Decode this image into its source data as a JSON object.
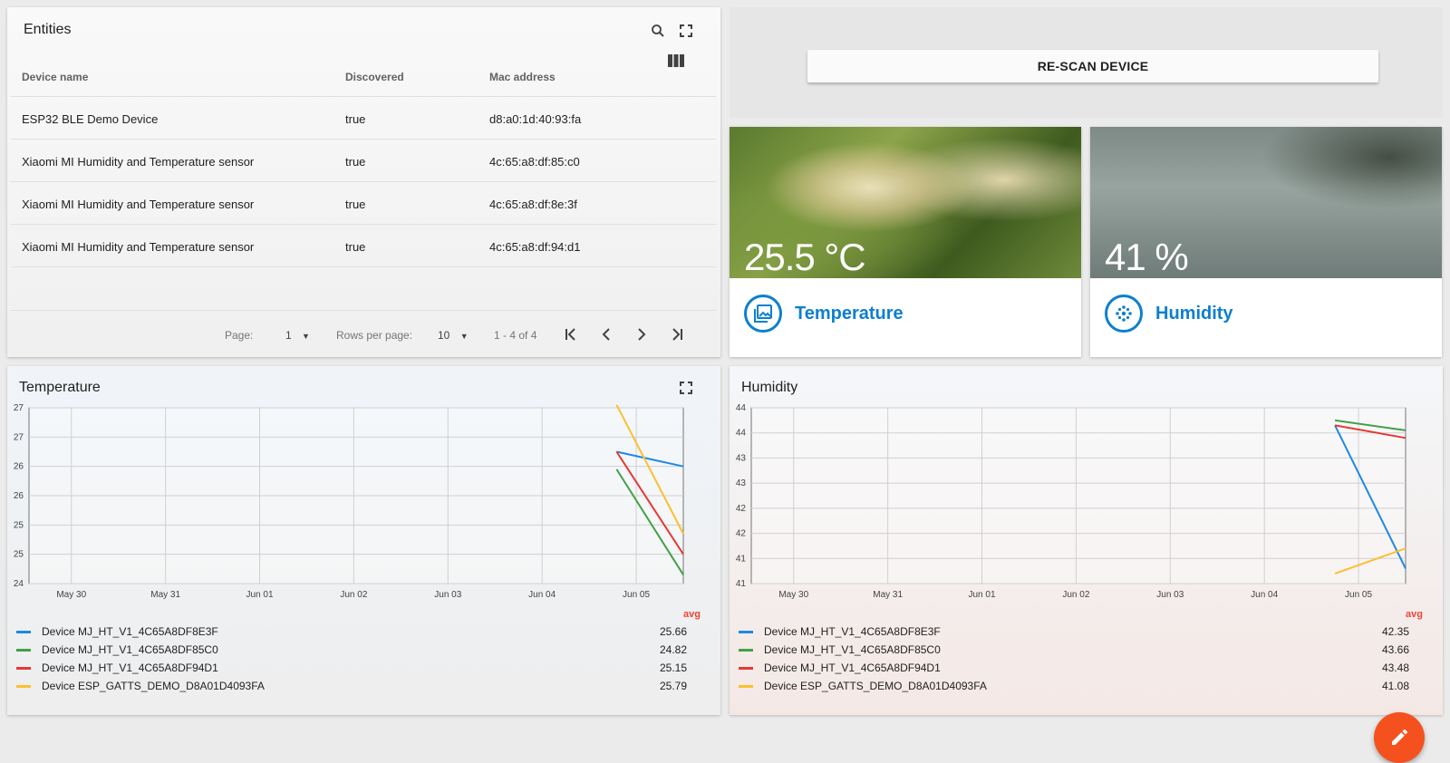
{
  "entities": {
    "title": "Entities",
    "columns": [
      "Device name",
      "Discovered",
      "Mac address"
    ],
    "rows": [
      {
        "name": "ESP32 BLE Demo Device",
        "discovered": "true",
        "mac": "d8:a0:1d:40:93:fa"
      },
      {
        "name": "Xiaomi MI Humidity and Temperature sensor",
        "discovered": "true",
        "mac": "4c:65:a8:df:85:c0"
      },
      {
        "name": "Xiaomi MI Humidity and Temperature sensor",
        "discovered": "true",
        "mac": "4c:65:a8:df:8e:3f"
      },
      {
        "name": "Xiaomi MI Humidity and Temperature sensor",
        "discovered": "true",
        "mac": "4c:65:a8:df:94:d1"
      }
    ],
    "pager": {
      "page_label": "Page:",
      "page": "1",
      "rows_label": "Rows per page:",
      "rows": "10",
      "range": "1 - 4 of 4"
    }
  },
  "rescan": {
    "label": "RE-SCAN DEVICE"
  },
  "tiles": {
    "temperature": {
      "value": "25.5 °C",
      "label": "Temperature"
    },
    "humidity": {
      "value": "41 %",
      "label": "Humidity"
    }
  },
  "charts": {
    "temperature": {
      "title": "Temperature",
      "avg_label": "avg"
    },
    "humidity": {
      "title": "Humidity",
      "avg_label": "avg"
    }
  },
  "colors": {
    "accent": "#0d7fcf",
    "fab": "#f4511e",
    "blue": "#1e88e5",
    "green": "#43a047",
    "red": "#e53935",
    "yellow": "#fbc02d"
  },
  "chart_data": [
    {
      "type": "line",
      "title": "Temperature",
      "x_ticks": [
        "May 30",
        "May 31",
        "Jun 01",
        "Jun 02",
        "Jun 03",
        "Jun 04",
        "Jun 05"
      ],
      "y_ticks": [
        "27",
        "27",
        "26",
        "26",
        "25",
        "25",
        "24"
      ],
      "ylim": [
        24,
        27
      ],
      "grid": true,
      "legend_position": "bottom",
      "series": [
        {
          "name": "Device MJ_HT_V1_4C65A8DF8E3F",
          "color": "#1e88e5",
          "x": [
            "Jun 04 19:00",
            "Jun 05 12:00"
          ],
          "y": [
            26.25,
            26.0
          ],
          "avg": "25.66"
        },
        {
          "name": "Device MJ_HT_V1_4C65A8DF85C0",
          "color": "#43a047",
          "x": [
            "Jun 04 19:00",
            "Jun 05 12:00"
          ],
          "y": [
            25.95,
            24.15
          ],
          "avg": "24.82"
        },
        {
          "name": "Device MJ_HT_V1_4C65A8DF94D1",
          "color": "#e53935",
          "x": [
            "Jun 04 19:00",
            "Jun 05 12:00"
          ],
          "y": [
            26.25,
            24.5
          ],
          "avg": "25.15"
        },
        {
          "name": "Device ESP_GATTS_DEMO_D8A01D4093FA",
          "color": "#fbc02d",
          "x": [
            "Jun 04 19:00",
            "Jun 05 12:00"
          ],
          "y": [
            27.05,
            24.85
          ],
          "avg": "25.79"
        }
      ]
    },
    {
      "type": "line",
      "title": "Humidity",
      "x_ticks": [
        "May 30",
        "May 31",
        "Jun 01",
        "Jun 02",
        "Jun 03",
        "Jun 04",
        "Jun 05"
      ],
      "y_ticks": [
        "44",
        "44",
        "43",
        "43",
        "42",
        "42",
        "41",
        "41"
      ],
      "ylim": [
        40.8,
        44.3
      ],
      "grid": true,
      "legend_position": "bottom",
      "series": [
        {
          "name": "Device MJ_HT_V1_4C65A8DF8E3F",
          "color": "#1e88e5",
          "x": [
            "Jun 04 18:00",
            "Jun 05 12:00"
          ],
          "y": [
            43.95,
            41.1
          ],
          "avg": "42.35"
        },
        {
          "name": "Device MJ_HT_V1_4C65A8DF85C0",
          "color": "#43a047",
          "x": [
            "Jun 04 18:00",
            "Jun 05 12:00"
          ],
          "y": [
            44.05,
            43.85
          ],
          "avg": "43.66"
        },
        {
          "name": "Device MJ_HT_V1_4C65A8DF94D1",
          "color": "#e53935",
          "x": [
            "Jun 04 18:00",
            "Jun 05 12:00"
          ],
          "y": [
            43.95,
            43.7
          ],
          "avg": "43.48"
        },
        {
          "name": "Device ESP_GATTS_DEMO_D8A01D4093FA",
          "color": "#fbc02d",
          "x": [
            "Jun 04 18:00",
            "Jun 05 12:00"
          ],
          "y": [
            41.0,
            41.5
          ],
          "avg": "41.08"
        }
      ]
    }
  ]
}
